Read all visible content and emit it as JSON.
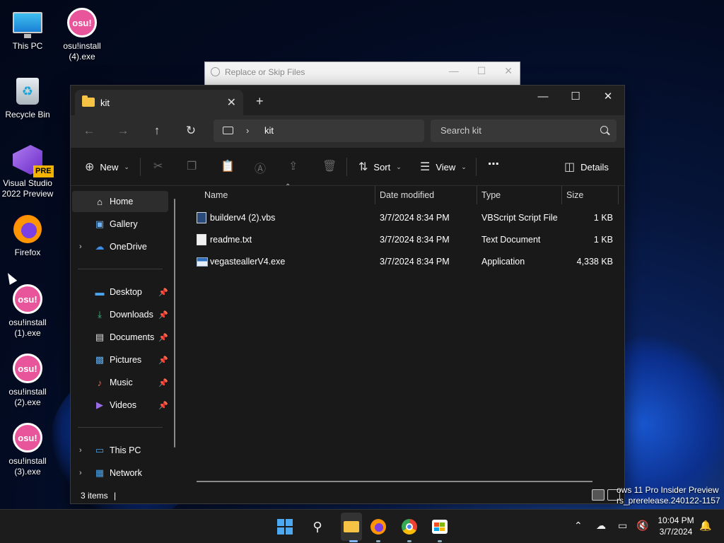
{
  "desktop": {
    "icons": [
      {
        "label": "This PC"
      },
      {
        "label": "osu!install\n(4).exe"
      },
      {
        "label": "Recycle Bin"
      },
      {
        "label": "Visual Studio\n2022 Preview"
      },
      {
        "label": "Firefox"
      },
      {
        "label": "osu!install\n(1).exe"
      },
      {
        "label": "osu!install\n(2).exe"
      },
      {
        "label": "osu!install\n(3).exe"
      }
    ],
    "osu_text": "osu!",
    "vs_badge": "PRE",
    "watermark_line1": "ows 11 Pro Insider Preview",
    "watermark_line2": "rs_prerelease.240122-1157"
  },
  "replace_dialog": {
    "title": "Replace or Skip Files"
  },
  "explorer": {
    "tab_title": "kit",
    "address": "kit",
    "search_placeholder": "Search kit",
    "commands": {
      "new": "New",
      "sort": "Sort",
      "view": "View",
      "details": "Details"
    },
    "sidebar": {
      "items": [
        {
          "label": "Home"
        },
        {
          "label": "Gallery"
        },
        {
          "label": "OneDrive"
        },
        {
          "label": "Desktop"
        },
        {
          "label": "Downloads"
        },
        {
          "label": "Documents"
        },
        {
          "label": "Pictures"
        },
        {
          "label": "Music"
        },
        {
          "label": "Videos"
        },
        {
          "label": "This PC"
        },
        {
          "label": "Network"
        }
      ]
    },
    "columns": [
      "Name",
      "Date modified",
      "Type",
      "Size"
    ],
    "files": [
      {
        "name": "builderv4 (2).vbs",
        "date": "3/7/2024 8:34 PM",
        "type": "VBScript Script File",
        "size": "1 KB"
      },
      {
        "name": "readme.txt",
        "date": "3/7/2024 8:34 PM",
        "type": "Text Document",
        "size": "1 KB"
      },
      {
        "name": "vegasteallerV4.exe",
        "date": "3/7/2024 8:34 PM",
        "type": "Application",
        "size": "4,338 KB"
      }
    ],
    "status": "3 items"
  },
  "taskbar": {
    "time": "10:04 PM",
    "date": "3/7/2024"
  }
}
